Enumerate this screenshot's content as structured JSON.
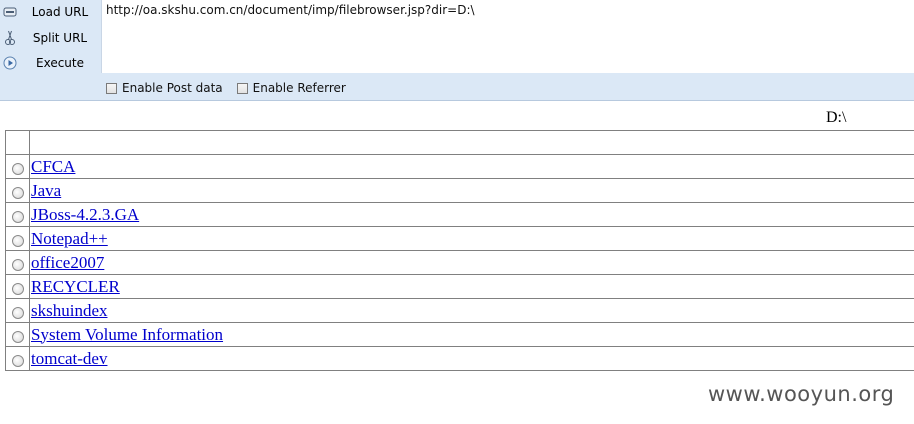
{
  "toolbar": {
    "load_url_label": "Load URL",
    "split_url_label": "Split URL",
    "execute_label": "Execute",
    "url_value": "http://oa.skshu.com.cn/document/imp/filebrowser.jsp?dir=D:\\",
    "enable_post_label": "Enable Post data",
    "enable_referrer_label": "Enable Referrer"
  },
  "browser": {
    "current_dir": "D:\\",
    "entries": [
      {
        "name": "CFCA"
      },
      {
        "name": "Java"
      },
      {
        "name": "JBoss-4.2.3.GA"
      },
      {
        "name": "Notepad++"
      },
      {
        "name": "office2007"
      },
      {
        "name": "RECYCLER"
      },
      {
        "name": "skshuindex"
      },
      {
        "name": "System Volume Information"
      },
      {
        "name": "tomcat-dev"
      }
    ]
  },
  "watermark": "www.wooyun.org",
  "colors": {
    "link": "#0000cc",
    "toolbar_bg": "#dbe8f6"
  }
}
